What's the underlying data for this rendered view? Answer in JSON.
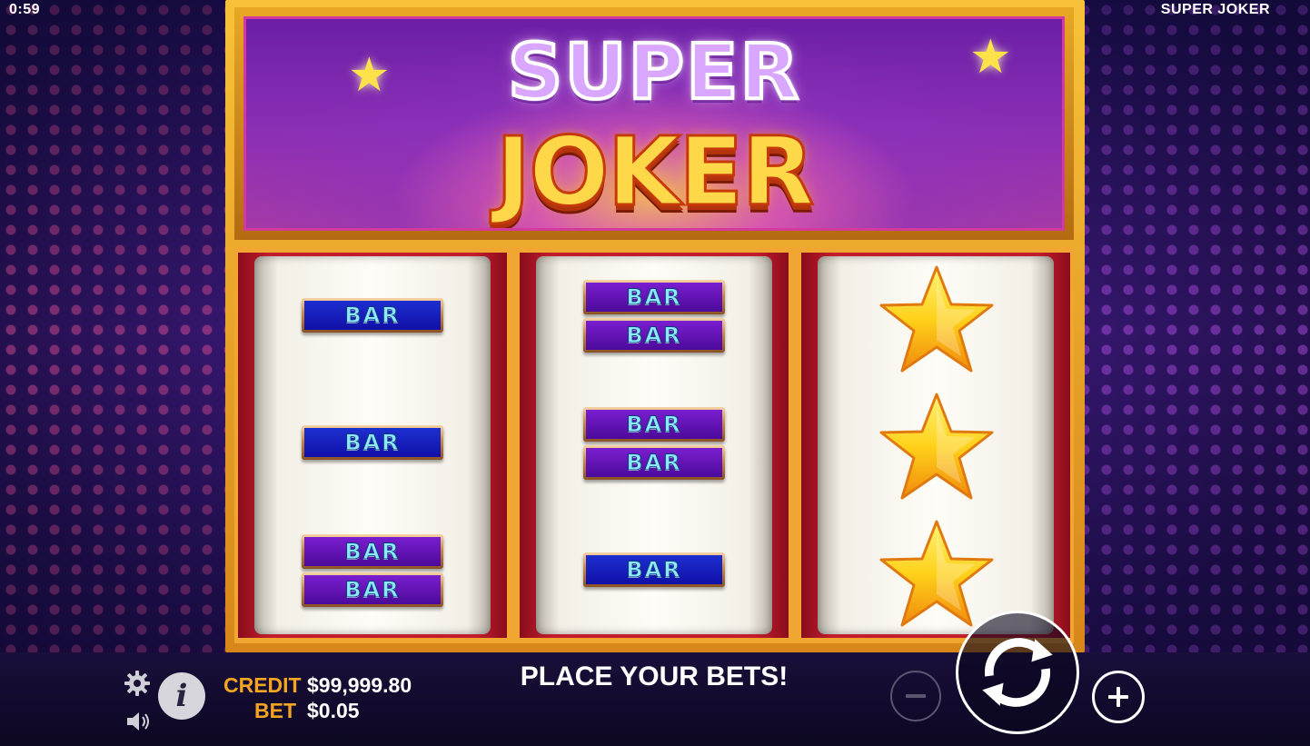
{
  "header": {
    "clock": "0:59",
    "game_name": "SUPER JOKER"
  },
  "marquee": {
    "title_line1": "SUPER",
    "title_line2": "JOKER"
  },
  "reels": [
    {
      "symbols": [
        {
          "type": "bar",
          "label": "BAR",
          "color": "blue"
        },
        {
          "type": "bar",
          "label": "BAR",
          "color": "blue"
        },
        {
          "type": "bar",
          "label": "BAR",
          "color": "purple"
        },
        {
          "type": "bar",
          "label": "BAR",
          "color": "purple"
        }
      ]
    },
    {
      "symbols": [
        {
          "type": "bar",
          "label": "BAR",
          "color": "purple"
        },
        {
          "type": "bar",
          "label": "BAR",
          "color": "purple"
        },
        {
          "type": "bar",
          "label": "BAR",
          "color": "purple"
        },
        {
          "type": "bar",
          "label": "BAR",
          "color": "purple"
        },
        {
          "type": "bar",
          "label": "BAR",
          "color": "blue"
        }
      ]
    },
    {
      "symbols": [
        {
          "type": "star"
        },
        {
          "type": "star"
        },
        {
          "type": "star"
        }
      ]
    }
  ],
  "footer": {
    "credit_label": "CREDIT",
    "credit_value": "$99,999.80",
    "bet_label": "BET",
    "bet_value": "$0.05",
    "message": "PLACE YOUR BETS!"
  },
  "icons": {
    "settings": "gear-icon",
    "sound": "speaker-icon",
    "info": "info-icon",
    "minus": "minus-icon",
    "spin": "spin-arrows-icon",
    "plus": "plus-icon"
  },
  "colors": {
    "credit_label": "#f4a623",
    "bar_blue": "#1d2fd0",
    "bar_purple": "#7a1ed0",
    "star": "#ffd21a"
  }
}
